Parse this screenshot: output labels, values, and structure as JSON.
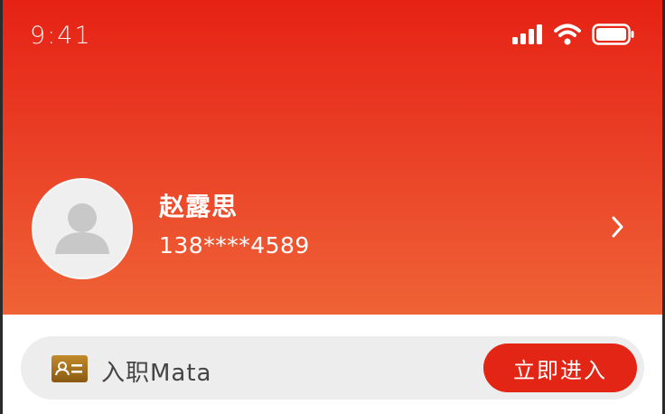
{
  "status_bar": {
    "time": "9:41",
    "icons": [
      "cellular-signal-icon",
      "wifi-icon",
      "battery-icon"
    ]
  },
  "profile": {
    "name": "赵露思",
    "phone": "138****4589",
    "avatar_icon": "user-placeholder-icon",
    "chevron_icon": "chevron-right-icon"
  },
  "entry": {
    "icon": "id-card-icon",
    "label": "入职Mata",
    "button_label": "立即进入"
  },
  "colors": {
    "header_top": "#e62214",
    "header_bottom": "#ef6336",
    "button": "#e32515",
    "entry_background": "#ededed"
  }
}
